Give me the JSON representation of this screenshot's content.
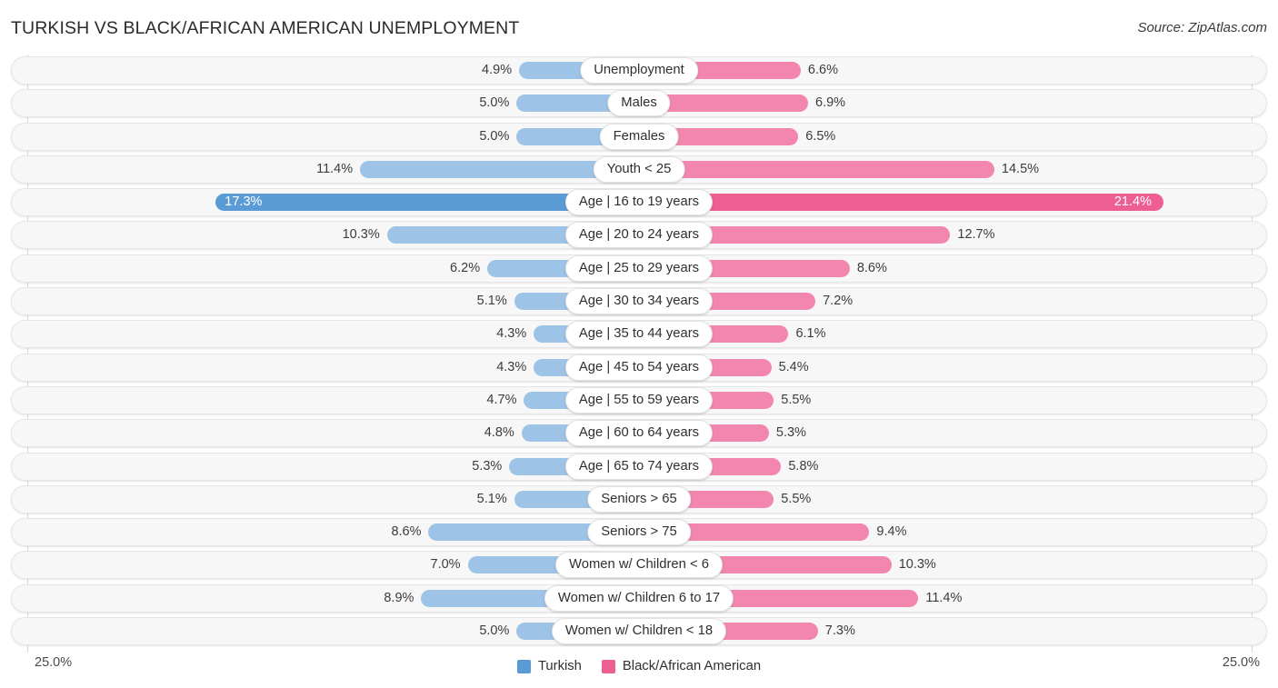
{
  "header": {
    "title": "TURKISH VS BLACK/AFRICAN AMERICAN UNEMPLOYMENT",
    "source": "Source: ZipAtlas.com"
  },
  "axis": {
    "left_label": "25.0%",
    "right_label": "25.0%",
    "max": 25.0
  },
  "legend": {
    "items": [
      {
        "label": "Turkish",
        "color": "#5b9bd5"
      },
      {
        "label": "Black/African American",
        "color": "#ed5e93"
      }
    ]
  },
  "colors": {
    "left_normal": "#9dc3e6",
    "left_max": "#5b9bd5",
    "right_normal": "#f286ae",
    "right_max": "#ed5e93",
    "track": "#f7f7f7",
    "text": "#3c3c3c"
  },
  "chart_data": {
    "type": "bar",
    "subtype": "diverging-bar",
    "title": "TURKISH VS BLACK/AFRICAN AMERICAN UNEMPLOYMENT",
    "xlabel": "",
    "ylabel": "",
    "xlim": [
      25.0,
      25.0
    ],
    "grid": true,
    "legend_position": "bottom-center",
    "categories": [
      "Unemployment",
      "Males",
      "Females",
      "Youth < 25",
      "Age | 16 to 19 years",
      "Age | 20 to 24 years",
      "Age | 25 to 29 years",
      "Age | 30 to 34 years",
      "Age | 35 to 44 years",
      "Age | 45 to 54 years",
      "Age | 55 to 59 years",
      "Age | 60 to 64 years",
      "Age | 65 to 74 years",
      "Seniors > 65",
      "Seniors > 75",
      "Women w/ Children < 6",
      "Women w/ Children 6 to 17",
      "Women w/ Children < 18"
    ],
    "series": [
      {
        "name": "Turkish",
        "side": "left",
        "color": "#9dc3e6",
        "values": [
          4.9,
          5.0,
          5.0,
          11.4,
          17.3,
          10.3,
          6.2,
          5.1,
          4.3,
          4.3,
          4.7,
          4.8,
          5.3,
          5.1,
          8.6,
          7.0,
          8.9,
          5.0
        ]
      },
      {
        "name": "Black/African American",
        "side": "right",
        "color": "#f286ae",
        "values": [
          6.6,
          6.9,
          6.5,
          14.5,
          21.4,
          12.7,
          8.6,
          7.2,
          6.1,
          5.4,
          5.5,
          5.3,
          5.8,
          5.5,
          9.4,
          10.3,
          11.4,
          7.3
        ]
      }
    ]
  },
  "rows": [
    {
      "label": "Unemployment",
      "left": "4.9%",
      "right": "6.6%",
      "left_value": 4.9,
      "right_value": 6.6,
      "max": false
    },
    {
      "label": "Males",
      "left": "5.0%",
      "right": "6.9%",
      "left_value": 5.0,
      "right_value": 6.9,
      "max": false
    },
    {
      "label": "Females",
      "left": "5.0%",
      "right": "6.5%",
      "left_value": 5.0,
      "right_value": 6.5,
      "max": false
    },
    {
      "label": "Youth < 25",
      "left": "11.4%",
      "right": "14.5%",
      "left_value": 11.4,
      "right_value": 14.5,
      "max": false
    },
    {
      "label": "Age | 16 to 19 years",
      "left": "17.3%",
      "right": "21.4%",
      "left_value": 17.3,
      "right_value": 21.4,
      "max": true
    },
    {
      "label": "Age | 20 to 24 years",
      "left": "10.3%",
      "right": "12.7%",
      "left_value": 10.3,
      "right_value": 12.7,
      "max": false
    },
    {
      "label": "Age | 25 to 29 years",
      "left": "6.2%",
      "right": "8.6%",
      "left_value": 6.2,
      "right_value": 8.6,
      "max": false
    },
    {
      "label": "Age | 30 to 34 years",
      "left": "5.1%",
      "right": "7.2%",
      "left_value": 5.1,
      "right_value": 7.2,
      "max": false
    },
    {
      "label": "Age | 35 to 44 years",
      "left": "4.3%",
      "right": "6.1%",
      "left_value": 4.3,
      "right_value": 6.1,
      "max": false
    },
    {
      "label": "Age | 45 to 54 years",
      "left": "4.3%",
      "right": "5.4%",
      "left_value": 4.3,
      "right_value": 5.4,
      "max": false
    },
    {
      "label": "Age | 55 to 59 years",
      "left": "4.7%",
      "right": "5.5%",
      "left_value": 4.7,
      "right_value": 5.5,
      "max": false
    },
    {
      "label": "Age | 60 to 64 years",
      "left": "4.8%",
      "right": "5.3%",
      "left_value": 4.8,
      "right_value": 5.3,
      "max": false
    },
    {
      "label": "Age | 65 to 74 years",
      "left": "5.3%",
      "right": "5.8%",
      "left_value": 5.3,
      "right_value": 5.8,
      "max": false
    },
    {
      "label": "Seniors > 65",
      "left": "5.1%",
      "right": "5.5%",
      "left_value": 5.1,
      "right_value": 5.5,
      "max": false
    },
    {
      "label": "Seniors > 75",
      "left": "8.6%",
      "right": "9.4%",
      "left_value": 8.6,
      "right_value": 9.4,
      "max": false
    },
    {
      "label": "Women w/ Children < 6",
      "left": "7.0%",
      "right": "10.3%",
      "left_value": 7.0,
      "right_value": 10.3,
      "max": false
    },
    {
      "label": "Women w/ Children 6 to 17",
      "left": "8.9%",
      "right": "11.4%",
      "left_value": 8.9,
      "right_value": 11.4,
      "max": false
    },
    {
      "label": "Women w/ Children < 18",
      "left": "5.0%",
      "right": "7.3%",
      "left_value": 5.0,
      "right_value": 7.3,
      "max": false
    }
  ]
}
